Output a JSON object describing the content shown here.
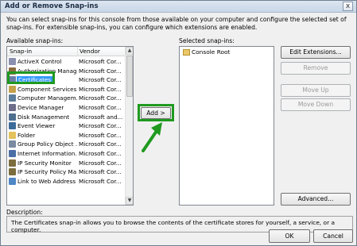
{
  "window": {
    "title": "Add or Remove Snap-ins",
    "close_glyph": "x"
  },
  "intro": "You can select snap-ins for this console from those available on your computer and configure the selected set of snap-ins. For extensible snap-ins, you can configure which extensions are enabled.",
  "available": {
    "label": "Available snap-ins:",
    "col_snapin": "Snap-in",
    "col_vendor": "Vendor",
    "items": [
      {
        "name": "ActiveX Control",
        "vendor": "Microsoft Cor...",
        "icon": "activex-icon",
        "color": "#8a8fb0"
      },
      {
        "name": "Authorization Manager",
        "vendor": "Microsoft Cor...",
        "icon": "authorization-icon",
        "color": "#8b6a3e"
      },
      {
        "name": "Certificates",
        "vendor": "Microsoft Cor...",
        "icon": "certificates-icon",
        "color": "#6b7fa8"
      },
      {
        "name": "Component Services",
        "vendor": "Microsoft Cor...",
        "icon": "component-services-icon",
        "color": "#c4a24a"
      },
      {
        "name": "Computer Managem...",
        "vendor": "Microsoft Cor...",
        "icon": "computer-management-icon",
        "color": "#5b7c9a"
      },
      {
        "name": "Device Manager",
        "vendor": "Microsoft Cor...",
        "icon": "device-manager-icon",
        "color": "#6d6d8a"
      },
      {
        "name": "Disk Management",
        "vendor": "Microsoft and...",
        "icon": "disk-management-icon",
        "color": "#4f6f8f"
      },
      {
        "name": "Event Viewer",
        "vendor": "Microsoft Cor...",
        "icon": "event-viewer-icon",
        "color": "#3d6b9a"
      },
      {
        "name": "Folder",
        "vendor": "Microsoft Cor...",
        "icon": "folder-icon",
        "color": "#e3c15c"
      },
      {
        "name": "Group Policy Object ...",
        "vendor": "Microsoft Cor...",
        "icon": "group-policy-icon",
        "color": "#7a8aa0"
      },
      {
        "name": "Internet Information...",
        "vendor": "Microsoft Cor...",
        "icon": "iis-icon",
        "color": "#4a6fa5"
      },
      {
        "name": "IP Security Monitor",
        "vendor": "Microsoft Cor...",
        "icon": "ip-security-monitor-icon",
        "color": "#7c6d3e"
      },
      {
        "name": "IP Security Policy Ma...",
        "vendor": "Microsoft Cor...",
        "icon": "ip-security-policy-icon",
        "color": "#7c6d3e"
      },
      {
        "name": "Link to Web Address",
        "vendor": "Microsoft Cor...",
        "icon": "link-web-icon",
        "color": "#4f86c6"
      }
    ]
  },
  "add_button": "Add >",
  "selected": {
    "label": "Selected snap-ins:",
    "items": [
      {
        "name": "Console Root",
        "icon": "folder-icon"
      }
    ]
  },
  "side_buttons": {
    "edit_extensions": "Edit Extensions...",
    "remove": "Remove",
    "move_up": "Move Up",
    "move_down": "Move Down",
    "advanced": "Advanced..."
  },
  "description": {
    "label": "Description:",
    "text": "The Certificates snap-in allows you to browse the contents of the certificate stores for yourself, a service, or a computer."
  },
  "footer": {
    "ok": "OK",
    "cancel": "Cancel"
  },
  "colors": {
    "highlight": "#1f9a1f",
    "selection": "#3399ff"
  }
}
